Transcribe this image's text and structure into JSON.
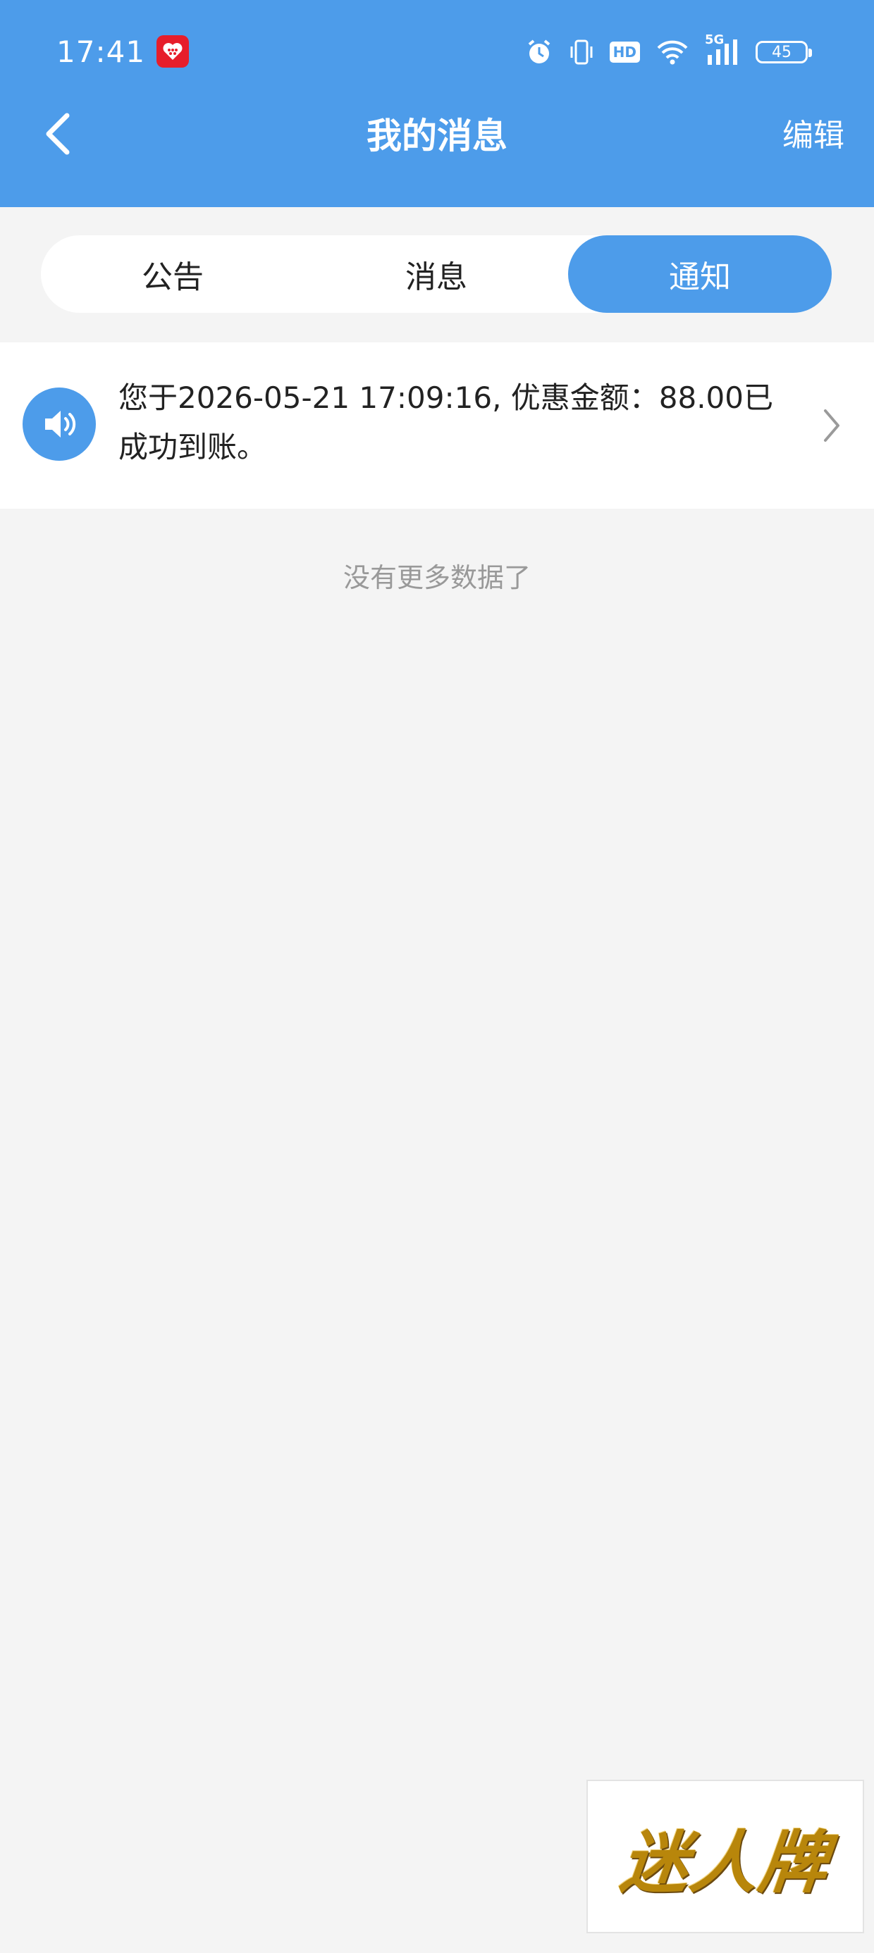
{
  "status_bar": {
    "time": "17:41",
    "hd_label": "HD",
    "network_label": "5G",
    "battery_level": "45"
  },
  "header": {
    "title": "我的消息",
    "edit_label": "编辑"
  },
  "tabs": [
    {
      "label": "公告",
      "active": false
    },
    {
      "label": "消息",
      "active": false
    },
    {
      "label": "通知",
      "active": true
    }
  ],
  "messages": [
    {
      "text": "您于2026-05-21 17:09:16, 优惠金额：88.00已成功到账。"
    }
  ],
  "footer": {
    "no_more_text": "没有更多数据了"
  },
  "logo": {
    "text": "迷人牌"
  },
  "colors": {
    "accent": "#4d9cea",
    "background": "#f4f4f4",
    "app_icon_red": "#e61e2b"
  }
}
